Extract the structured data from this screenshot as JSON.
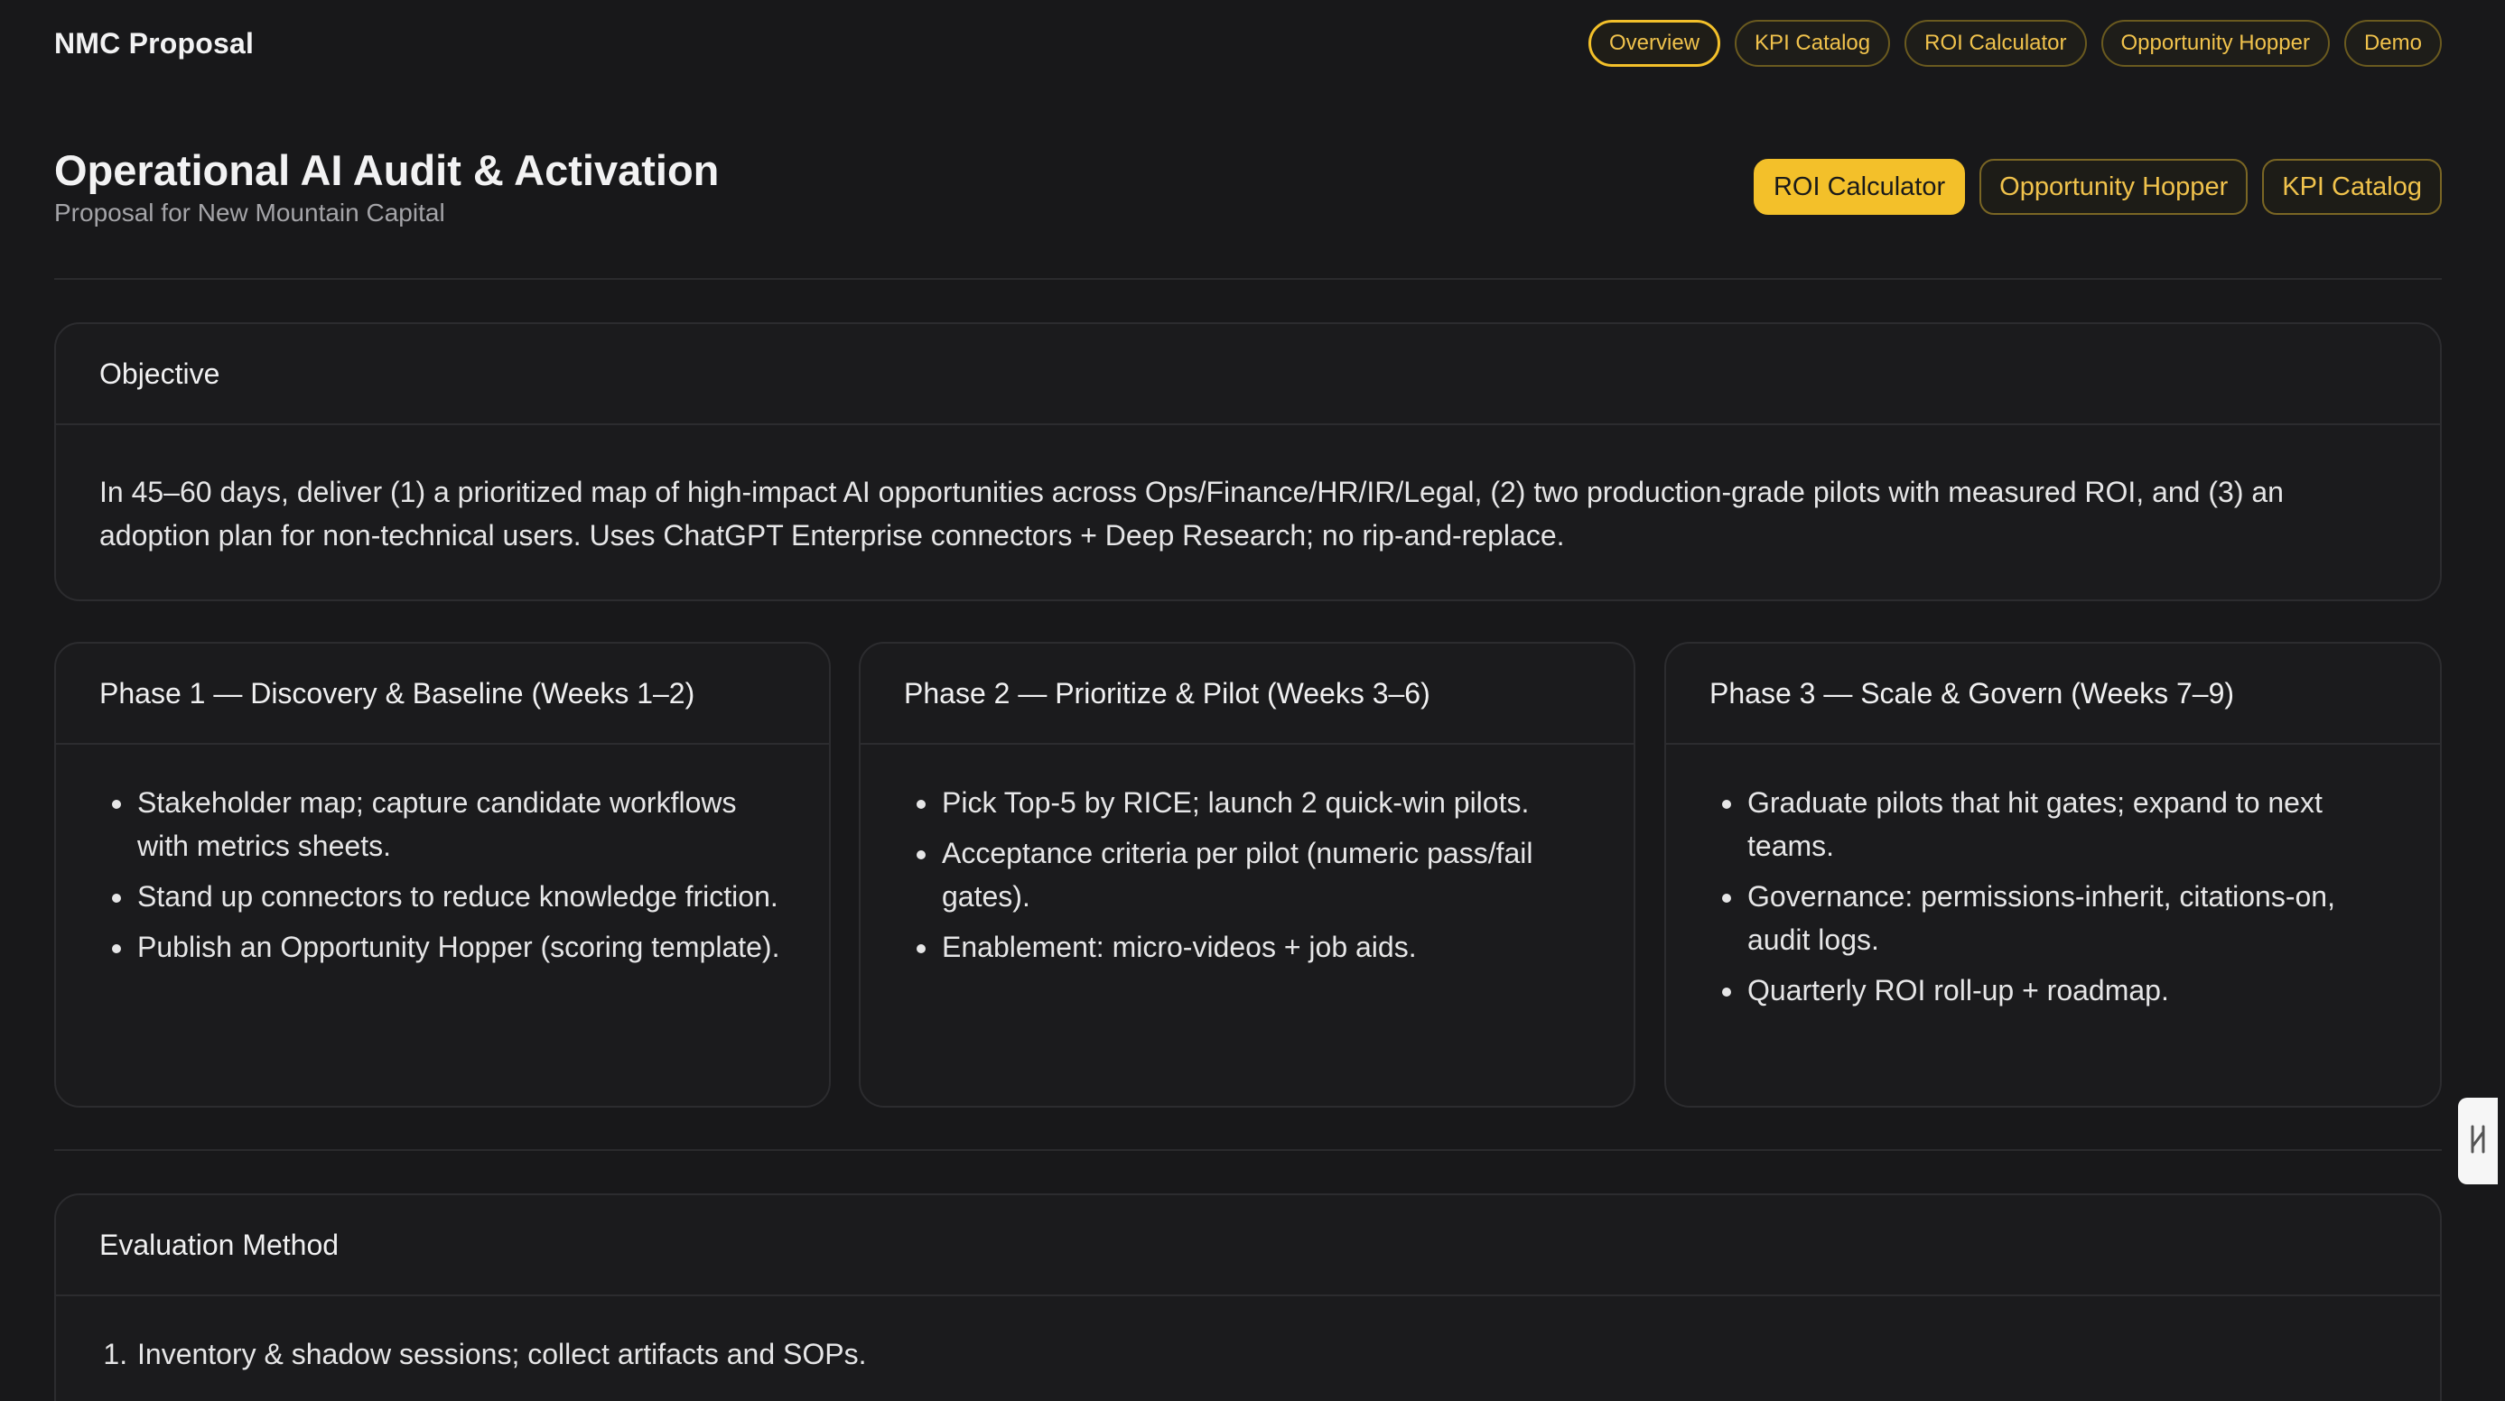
{
  "app": {
    "brand": "NMC Proposal"
  },
  "nav": [
    {
      "label": "Overview",
      "active": true
    },
    {
      "label": "KPI Catalog"
    },
    {
      "label": "ROI Calculator"
    },
    {
      "label": "Opportunity Hopper"
    },
    {
      "label": "Demo"
    }
  ],
  "header": {
    "title": "Operational AI Audit & Activation",
    "subtitle": "Proposal for New Mountain Capital",
    "actions": [
      {
        "label": "ROI Calculator",
        "style": "primary"
      },
      {
        "label": "Opportunity Hopper",
        "style": "outline"
      },
      {
        "label": "KPI Catalog",
        "style": "outline"
      }
    ]
  },
  "objective": {
    "heading": "Objective",
    "text": "In 45–60 days, deliver (1) a prioritized map of high-impact AI opportunities across Ops/Finance/HR/IR/Legal, (2) two production-grade pilots with measured ROI, and (3) an adoption plan for non-technical users. Uses ChatGPT Enterprise connectors + Deep Research; no rip-and-replace."
  },
  "phases": [
    {
      "heading": "Phase 1 — Discovery & Baseline (Weeks 1–2)",
      "items": [
        "Stakeholder map; capture candidate workflows with metrics sheets.",
        "Stand up connectors to reduce knowledge friction.",
        "Publish an Opportunity Hopper (scoring template)."
      ]
    },
    {
      "heading": "Phase 2 — Prioritize & Pilot (Weeks 3–6)",
      "items": [
        "Pick Top-5 by RICE; launch 2 quick-win pilots.",
        "Acceptance criteria per pilot (numeric pass/fail gates).",
        "Enablement: micro-videos + job aids."
      ]
    },
    {
      "heading": "Phase 3 — Scale & Govern (Weeks 7–9)",
      "items": [
        "Graduate pilots that hit gates; expand to next teams.",
        "Governance: permissions-inherit, citations-on, audit logs.",
        "Quarterly ROI roll-up + roadmap."
      ]
    }
  ],
  "evaluation": {
    "heading": "Evaluation Method",
    "steps": [
      "Inventory & shadow sessions; collect artifacts and SOPs."
    ]
  },
  "colors": {
    "background": "#18181a",
    "accent": "#f3c02a",
    "accent_text": "#f0c24c",
    "card_border": "#2c2c2f"
  },
  "icons": {
    "side_handle": "sidebar-toggle-icon"
  }
}
